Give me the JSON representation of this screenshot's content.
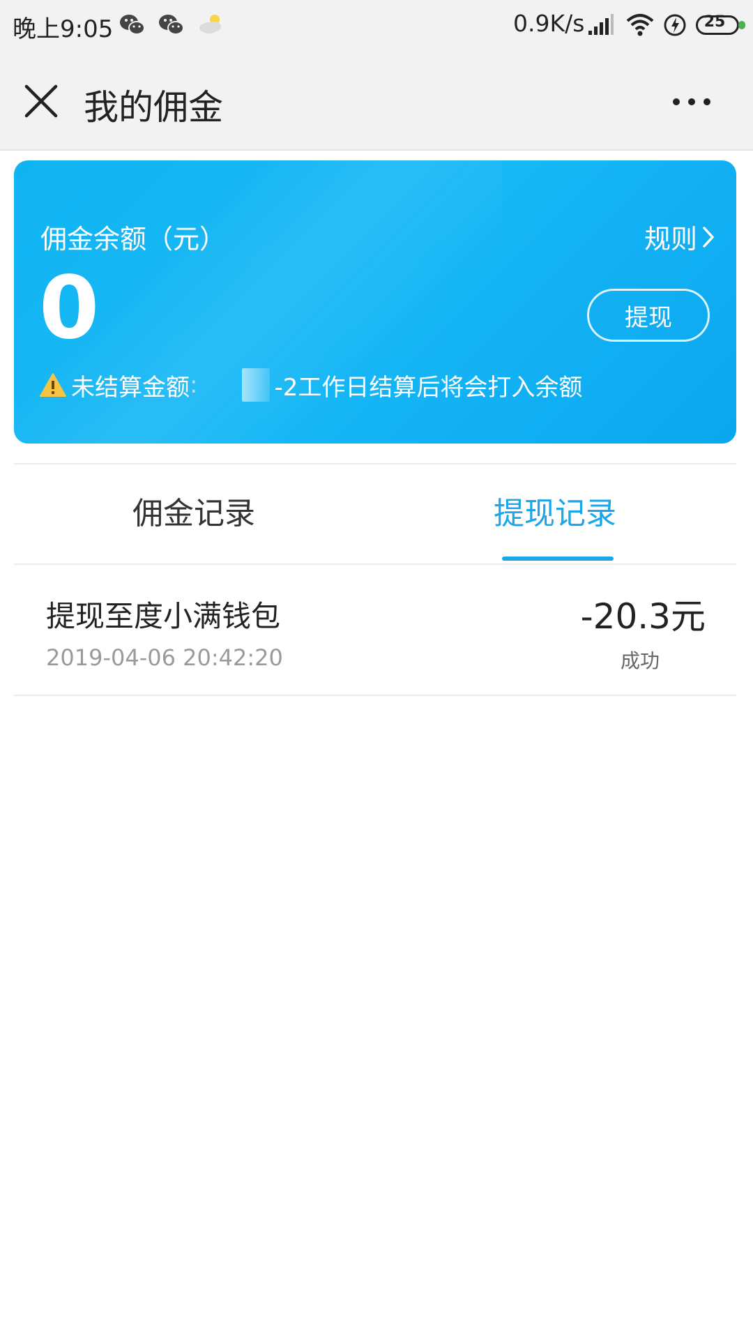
{
  "status_bar": {
    "time": "晚上9:05",
    "network_speed": "0.9K/s",
    "battery_level": "25",
    "icons": [
      "wechat-icon",
      "wechat-icon",
      "weather-icon",
      "signal-icon",
      "wifi-icon",
      "charging-icon",
      "battery-icon"
    ],
    "battery_color": "#4caf50"
  },
  "header": {
    "title": "我的佣金",
    "close_icon": "close-icon",
    "more_icon": "more-icon"
  },
  "balance_card": {
    "label": "佣金余额（元）",
    "rules_label": "规则",
    "balance": "0",
    "withdraw_button": "提现",
    "pending_label": "未结算金额",
    "pending_colon": ":",
    "pending_note": "-2工作日结算后将会打入余额",
    "accent_color": "#11b4f2"
  },
  "tabs": [
    {
      "label": "佣金记录",
      "active": false
    },
    {
      "label": "提现记录",
      "active": true
    }
  ],
  "active_tab_color": "#1aa6e8",
  "records": [
    {
      "title": "提现至度小满钱包",
      "time": "2019-04-06 20:42:20",
      "amount": "-20.3元",
      "status": "成功"
    }
  ]
}
